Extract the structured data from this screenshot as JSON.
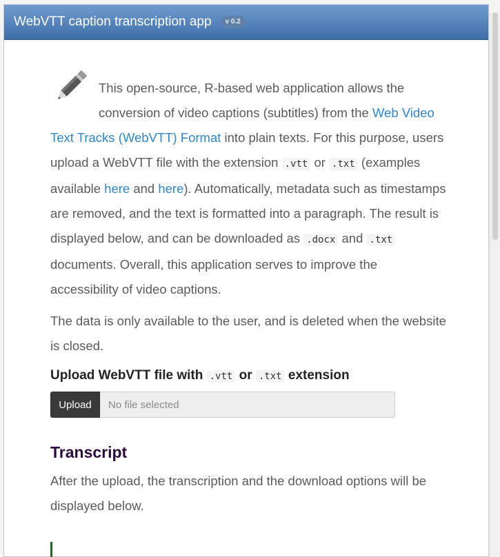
{
  "app": {
    "title": "WebVTT caption transcription app",
    "version": "v 0.2"
  },
  "intro": {
    "seg1": "This open-source, R-based web application allows the conversion of video captions (subtitles) from the ",
    "link_webvtt": "Web Video Text Tracks (WebVTT) Format",
    "seg2": " into plain texts. For this purpose, users upload a WebVTT file with the extension ",
    "code_vtt": ".vtt",
    "seg3": " or ",
    "code_txt": ".txt",
    "seg4": " (examples available ",
    "link_here1": "here",
    "seg5": " and ",
    "link_here2": "here",
    "seg6": "). Automatically, metadata such as timestamps are removed, and the text is formatted into a paragraph. The result is displayed below, and can be downloaded as ",
    "code_docx": ".docx",
    "seg7": " and ",
    "code_txt2": ".txt",
    "seg8": " documents. Overall, this application serves to improve the accessibility of video captions."
  },
  "privacy": "The data is only available to the user, and is deleted when the website is closed.",
  "upload": {
    "label_pre": "Upload WebVTT file with ",
    "code_vtt": ".vtt",
    "label_or": " or ",
    "code_txt": ".txt",
    "label_post": " extension",
    "button": "Upload",
    "placeholder": "No file selected"
  },
  "transcript": {
    "heading": "Transcript",
    "text": "After the upload, the transcription and the download options will be displayed below."
  },
  "icons": {
    "intro": "pencil-icon"
  },
  "colors": {
    "header": "#4a7ab5",
    "link": "#2f86c9",
    "heading": "#2b0a3d",
    "accent_bar": "#1f6b1f"
  }
}
